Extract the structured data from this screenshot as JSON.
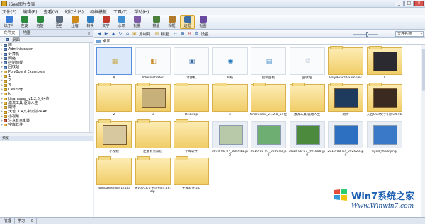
{
  "window": {
    "title": "iSee图片专家",
    "buttons": [
      "_",
      "□",
      "×"
    ]
  },
  "menu": [
    "文件(F)",
    "编辑(E)",
    "查看(V)",
    "幻灯片(S)",
    "相框模板",
    "工具(T)",
    "帮助(H)"
  ],
  "toolbar": [
    {
      "label": "幻灯片",
      "icon": "slideshow-icon",
      "color": "#3a7bd5"
    },
    {
      "label": "左旋",
      "icon": "rotate-left-icon",
      "color": "#2b8a3e"
    },
    {
      "label": "右旋",
      "icon": "rotate-right-icon",
      "color": "#2b8a3e"
    },
    {
      "label": "更名",
      "icon": "rename-icon",
      "color": "#5b6b80"
    },
    {
      "label": "压缩",
      "icon": "compress-icon",
      "color": "#d08a18"
    },
    {
      "label": "转换",
      "icon": "convert-icon",
      "color": "#2f7ec2"
    },
    {
      "label": "文字",
      "icon": "text-icon",
      "color": "#c0392b"
    },
    {
      "label": "水印",
      "icon": "watermark-icon",
      "color": "#3f8fd1"
    },
    {
      "label": "批量",
      "icon": "batch-icon",
      "color": "#7d5ba6"
    },
    {
      "label": "排版",
      "icon": "layout-icon",
      "color": "#4a7f3c"
    },
    {
      "label": "相框",
      "icon": "frame-icon",
      "color": "#b07a2a"
    },
    {
      "label": "边框",
      "icon": "border-icon",
      "color": "#3a6ea5",
      "active": true
    },
    {
      "label": "抠图",
      "icon": "cutout-icon",
      "color": "#6a4aa0"
    }
  ],
  "left_tabs": [
    "文件夹",
    "地图"
  ],
  "tree": {
    "root": "桌面",
    "items": [
      {
        "label": "库",
        "icon": "sys"
      },
      {
        "label": "Administrator",
        "icon": "sys"
      },
      {
        "label": "计算机",
        "icon": "sys"
      },
      {
        "label": "网络",
        "icon": "sys"
      },
      {
        "label": "控制面板",
        "icon": "sys"
      },
      {
        "label": "回收站",
        "icon": "sys"
      },
      {
        "label": "PolyBoard Examples",
        "icon": "folder"
      },
      {
        "label": "1",
        "icon": "folder"
      },
      {
        "label": "2",
        "icon": "folder"
      },
      {
        "label": "3",
        "icon": "folder"
      },
      {
        "label": "Desktop",
        "icon": "folder"
      },
      {
        "label": "k",
        "icon": "folder"
      },
      {
        "label": "tinaruseer_v1.2.0_64位",
        "icon": "folder"
      },
      {
        "label": "激流工具 驱动人生",
        "icon": "folder"
      },
      {
        "label": "期待",
        "icon": "folder"
      },
      {
        "label": "天若OCR文字识别v4.46",
        "icon": "folder"
      },
      {
        "label": "小视频",
        "icon": "folder"
      },
      {
        "label": "注意有点家装",
        "icon": "red"
      },
      {
        "label": "字库软件",
        "icon": "folder"
      }
    ]
  },
  "preview_label": "预览",
  "nav": {
    "copy_to": "复制到",
    "move": "移至",
    "settings": "设置",
    "sort": "文件名称"
  },
  "path": "桌面",
  "thumbnails": [
    {
      "caption": "库",
      "kind": "sys",
      "glyph": "▦",
      "gcolor": "#c9a94a"
    },
    {
      "caption": "Administrator",
      "kind": "sys",
      "glyph": "◧",
      "gcolor": "#c98c2a"
    },
    {
      "caption": "计算机",
      "kind": "sys",
      "glyph": "▣",
      "gcolor": "#3a6ea5"
    },
    {
      "caption": "网络",
      "kind": "sys",
      "glyph": "◉",
      "gcolor": "#2f7ec2"
    },
    {
      "caption": "控制面板",
      "kind": "sys",
      "glyph": "▤",
      "gcolor": "#4a90c8"
    },
    {
      "caption": "回收站",
      "kind": "sys",
      "glyph": "♲",
      "gcolor": "#6f8fa8"
    },
    {
      "caption": "PolyBoard Examples",
      "kind": "folder"
    },
    {
      "caption": "1",
      "kind": "folder-img",
      "tone": "#2a2a30"
    },
    {
      "caption": "2",
      "kind": "folder"
    },
    {
      "caption": "3",
      "kind": "folder-img",
      "tone": "#c8b07a"
    },
    {
      "caption": "Desktop",
      "kind": "folder"
    },
    {
      "caption": "k",
      "kind": "folder"
    },
    {
      "caption": "tinaruseer_v1.2.0_64位",
      "kind": "folder"
    },
    {
      "caption": "激流工具 驱动人生",
      "kind": "folder"
    },
    {
      "caption": "期待",
      "kind": "folder-img",
      "tone": "#1e3a5c"
    },
    {
      "caption": "天若OCR文字识别v4.46",
      "kind": "folder-img",
      "tone": "#3a2a20"
    },
    {
      "caption": "小视频",
      "kind": "folder-img",
      "tone": "#d8c8a0"
    },
    {
      "caption": "注意有点家装",
      "kind": "folder"
    },
    {
      "caption": "字库软件",
      "kind": "folder"
    },
    {
      "caption": "2019-08-07_085941.jpg",
      "kind": "img",
      "tone": "#b7c9a8"
    },
    {
      "caption": "2019-08-07_090048.jpg",
      "kind": "img",
      "tone": "#6fae72"
    },
    {
      "caption": "2019-08-07_091000.jpg",
      "kind": "img",
      "tone": "#4c8a3e"
    },
    {
      "caption": "2019-08-07_092528.jpg",
      "kind": "img",
      "tone": "#2d6fc0"
    },
    {
      "caption": "kyod_0000.png",
      "kind": "img",
      "tone": "#3a78c8"
    },
    {
      "caption": "wingamenikel1).zip",
      "kind": "folder"
    },
    {
      "caption": "天若OCR文字识别v4.46.zip",
      "kind": "folder"
    },
    {
      "caption": "字库软件.zip",
      "kind": "folder"
    }
  ],
  "status": [
    "管理",
    "学习",
    "8"
  ],
  "watermark": {
    "brand": "Win7系统之家",
    "url": "Www.Winwin7.com"
  }
}
